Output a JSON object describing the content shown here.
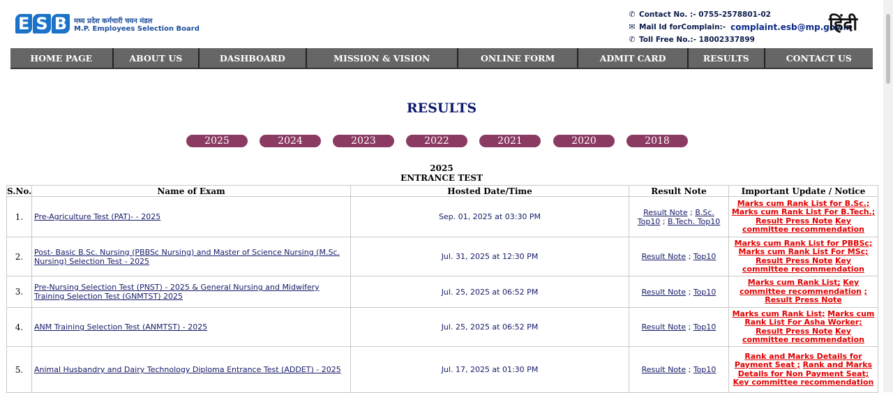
{
  "header": {
    "logo_letters": [
      "E",
      "S",
      "B"
    ],
    "org_name_hindi": "मध्य प्रदेश कर्मचारी चयन मंडल",
    "org_name_english": "M.P. Employees Selection Board",
    "contact_line": "Contact No. :- 0755-2578801-02",
    "mail_label": "Mail Id forComplain:-",
    "mail_value": "complaint.esb@mp.gov.in",
    "toll_free": "Toll Free No.:- 18002337899",
    "language_toggle": "हिंदी"
  },
  "nav": {
    "items": [
      {
        "label": "HOME PAGE"
      },
      {
        "label": "ABOUT US"
      },
      {
        "label": "DASHBOARD"
      },
      {
        "label": "MISSION & VISION"
      },
      {
        "label": "ONLINE FORM"
      },
      {
        "label": "ADMIT CARD"
      },
      {
        "label": "RESULTS"
      },
      {
        "label": "CONTACT US"
      }
    ]
  },
  "page": {
    "title": "RESULTS",
    "years": [
      "2025",
      "2024",
      "2023",
      "2022",
      "2021",
      "2020",
      "2018"
    ],
    "section_year": "2025",
    "section_title": "ENTRANCE TEST"
  },
  "table": {
    "headers": [
      "S.No.",
      "Name of Exam",
      "Hosted Date/Time",
      "Result Note",
      "Important Update / Notice"
    ],
    "rows": [
      {
        "sno": "1.",
        "name": "Pre-Agriculture Test (PAT)- - 2025",
        "date": "Sep. 01, 2025 at 03:30 PM",
        "note_parts": [
          {
            "link": "Result Note"
          },
          {
            "sep": " ; "
          },
          {
            "link": "B.Sc. Top10"
          },
          {
            "sep": " ; "
          },
          {
            "link": "B.Tech. Top10"
          }
        ],
        "notices": [
          "Marks cum Rank List for B.Sc.;",
          "Marks cum Rank List For B.Tech.;",
          "Result Press Note",
          "Key committee recommendation"
        ]
      },
      {
        "sno": "2.",
        "name": "Post- Basic B.Sc. Nursing (PBBSc Nursing) and Master of Science Nursing (M.Sc. Nursing) Selection Test - 2025",
        "date": "Jul. 31, 2025 at 12:30 PM",
        "note_parts": [
          {
            "link": "Result Note"
          },
          {
            "sep": " ; "
          },
          {
            "link": "Top10"
          }
        ],
        "notices": [
          "Marks cum Rank List for PBBSc;",
          "Marks cum Rank List For MSc;",
          "Result Press Note",
          "Key committee recommendation"
        ]
      },
      {
        "sno": "3.",
        "name": "Pre-Nursing Selection Test (PNST) - 2025 & General Nursing and Midwifery Training Selection Test (GNMTST) 2025",
        "date": "Jul. 25, 2025 at 06:52 PM",
        "note_parts": [
          {
            "link": "Result Note"
          },
          {
            "sep": " ; "
          },
          {
            "link": "Top10"
          }
        ],
        "notices": [
          "Marks cum Rank List;",
          "Key committee recommendation",
          ";",
          "Result Press Note"
        ]
      },
      {
        "sno": "4.",
        "name": "ANM Training Selection Test (ANMTST) - 2025",
        "date": "Jul. 25, 2025 at 06:52 PM",
        "note_parts": [
          {
            "link": "Result Note"
          },
          {
            "sep": " ; "
          },
          {
            "link": "Top10"
          }
        ],
        "notices": [
          "Marks cum Rank List;",
          "Marks cum Rank List For Asha Worker;",
          "Result Press Note",
          "Key committee recommendation"
        ]
      },
      {
        "sno": "5.",
        "name": "Animal Husbandry and Dairy Technology Diploma Entrance Test (ADDET) - 2025",
        "date": "Jul. 17, 2025 at 01:30 PM",
        "note_parts": [
          {
            "link": "Result Note"
          },
          {
            "sep": " ; "
          },
          {
            "link": "Top10"
          }
        ],
        "notices": [
          "Rank and Marks Details for Payment Seat ;",
          "Rank and Marks Details for Non Payment Seat;",
          "Key committee recommendation"
        ]
      }
    ]
  },
  "colors": {
    "nav_bg": "#666666",
    "year_pill": "#8b3a62",
    "title": "#0d1a6e",
    "notice_red": "#e00000"
  }
}
